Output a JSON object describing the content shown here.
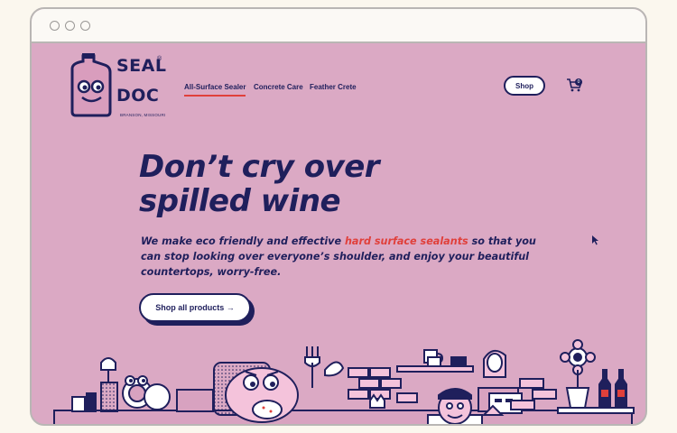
{
  "brand": {
    "logo_line1": "SEAL",
    "logo_line2": "DOC",
    "logo_registered": "®",
    "logo_location": "BRANSON, MISSOURI"
  },
  "nav": {
    "items": [
      {
        "label": "All-Surface Sealer",
        "active": true
      },
      {
        "label": "Concrete Care",
        "active": false
      },
      {
        "label": "Feather Crete",
        "active": false
      }
    ],
    "shop_label": "Shop",
    "cart_count": "0"
  },
  "hero": {
    "headline_line1": "Don’t cry over",
    "headline_line2": "spilled wine",
    "body_before": "We make eco friendly and effective ",
    "body_highlight": "hard surface sealants",
    "body_after": " so that you can stop looking over everyone’s shoulder, and enjoy your beautiful countertops, worry-free.",
    "cta_label": "Shop all products →"
  },
  "colors": {
    "background": "#dba9c4",
    "ink": "#1f1f5c",
    "accent": "#e0403b"
  },
  "icons": {
    "cart": "cart-icon",
    "arrow": "arrow-right-icon"
  }
}
